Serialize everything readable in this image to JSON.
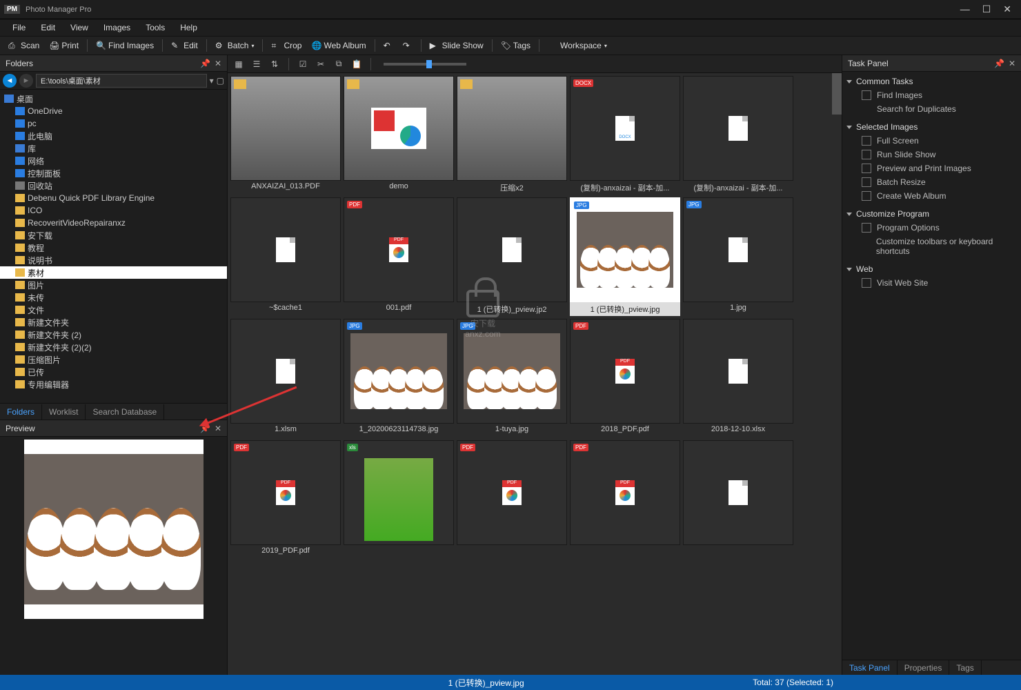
{
  "window": {
    "title": "Photo Manager Pro"
  },
  "menu": [
    "File",
    "Edit",
    "View",
    "Images",
    "Tools",
    "Help"
  ],
  "toolbar": [
    {
      "icon": "scan",
      "label": "Scan"
    },
    {
      "icon": "print",
      "label": "Print"
    },
    {
      "sep": true
    },
    {
      "icon": "find",
      "label": "Find Images"
    },
    {
      "sep": true
    },
    {
      "icon": "edit",
      "label": "Edit"
    },
    {
      "sep": true
    },
    {
      "icon": "batch",
      "label": "Batch",
      "dd": true
    },
    {
      "sep": true
    },
    {
      "icon": "crop",
      "label": "Crop"
    },
    {
      "icon": "web",
      "label": "Web Album"
    },
    {
      "sep": true
    },
    {
      "icon": "rotl",
      "label": ""
    },
    {
      "icon": "rotr",
      "label": ""
    },
    {
      "sep": true
    },
    {
      "icon": "slide",
      "label": "Slide Show"
    },
    {
      "sep": true
    },
    {
      "icon": "tags",
      "label": "Tags"
    },
    {
      "sep": true
    },
    {
      "icon": "ws",
      "label": "Workspace",
      "dd": true
    }
  ],
  "folders": {
    "title": "Folders",
    "path": "E:\\tools\\桌面\\素材",
    "root": "桌面",
    "items": [
      {
        "icon": "cloud",
        "label": "OneDrive",
        "ind": 1,
        "color": "#2a7de1"
      },
      {
        "icon": "pc",
        "label": "pc",
        "ind": 1,
        "color": "#2a7de1"
      },
      {
        "icon": "pc2",
        "label": "此电脑",
        "ind": 1,
        "color": "#2a7de1"
      },
      {
        "icon": "lib",
        "label": "库",
        "ind": 1,
        "color": "#3a7bd5"
      },
      {
        "icon": "net",
        "label": "网络",
        "ind": 1,
        "color": "#2a7de1"
      },
      {
        "icon": "cp",
        "label": "控制面板",
        "ind": 1,
        "color": "#2a7de1"
      },
      {
        "icon": "bin",
        "label": "回收站",
        "ind": 1,
        "color": "#777"
      },
      {
        "icon": "f",
        "label": "Debenu Quick PDF Library Engine",
        "ind": 1,
        "color": "#e8b84a"
      },
      {
        "icon": "f",
        "label": "ICO",
        "ind": 1,
        "color": "#e8b84a"
      },
      {
        "icon": "f",
        "label": "RecoveritVideoRepairanxz",
        "ind": 1,
        "color": "#e8b84a"
      },
      {
        "icon": "f",
        "label": "安下载",
        "ind": 1,
        "color": "#e8b84a"
      },
      {
        "icon": "f",
        "label": "教程",
        "ind": 1,
        "color": "#e8b84a"
      },
      {
        "icon": "f",
        "label": "说明书",
        "ind": 1,
        "color": "#e8b84a"
      },
      {
        "icon": "f",
        "label": "素材",
        "ind": 1,
        "color": "#e8b84a",
        "sel": true
      },
      {
        "icon": "f",
        "label": "图片",
        "ind": 1,
        "color": "#e8b84a"
      },
      {
        "icon": "f",
        "label": "未传",
        "ind": 1,
        "color": "#e8b84a"
      },
      {
        "icon": "f",
        "label": "文件",
        "ind": 1,
        "color": "#e8b84a"
      },
      {
        "icon": "f",
        "label": "新建文件夹",
        "ind": 1,
        "color": "#e8b84a"
      },
      {
        "icon": "f",
        "label": "新建文件夹 (2)",
        "ind": 1,
        "color": "#e8b84a"
      },
      {
        "icon": "f",
        "label": "新建文件夹 (2)(2)",
        "ind": 1,
        "color": "#e8b84a"
      },
      {
        "icon": "f",
        "label": "压缩图片",
        "ind": 1,
        "color": "#e8b84a"
      },
      {
        "icon": "f",
        "label": "已传",
        "ind": 1,
        "color": "#e8b84a"
      },
      {
        "icon": "f",
        "label": "专用编辑器",
        "ind": 1,
        "color": "#e8b84a"
      }
    ],
    "tabs": [
      "Folders",
      "Worklist",
      "Search Database"
    ]
  },
  "preview": {
    "title": "Preview"
  },
  "files": [
    {
      "type": "folder",
      "label": "ANXAIZAI_013.PDF"
    },
    {
      "type": "folder",
      "label": "demo",
      "demo": true
    },
    {
      "type": "folder",
      "label": "压缩x2"
    },
    {
      "type": "docx",
      "label": "(复制)-anxaizai - 副本-加...",
      "badge": "DOCX"
    },
    {
      "type": "doc",
      "label": "(复制)-anxaizai - 副本-加..."
    },
    {
      "type": "doc",
      "label": "~$cache1"
    },
    {
      "type": "pdfcolor",
      "label": "001.pdf"
    },
    {
      "type": "doc",
      "label": "1 (已转换)_pview.jp2"
    },
    {
      "type": "jpgpups",
      "label": "1 (已转换)_pview.jpg",
      "sel": true,
      "badge": "JPG"
    },
    {
      "type": "doc",
      "label": "1.jpg",
      "badge": "JPG"
    },
    {
      "type": "doc",
      "label": "1.xlsm"
    },
    {
      "type": "jpgpups",
      "label": "1_20200623114738.jpg",
      "badge": "JPG"
    },
    {
      "type": "jpgpups",
      "label": "1-tuya.jpg",
      "badge": "JPG"
    },
    {
      "type": "pdfcolor",
      "label": "2018_PDF.pdf",
      "badge": "PDF"
    },
    {
      "type": "doc",
      "label": "2018-12-10.xlsx"
    },
    {
      "type": "pdfcolor",
      "label": "2019_PDF.pdf",
      "badge": "PDF"
    },
    {
      "type": "girl",
      "label": "",
      "badge": "XLS"
    },
    {
      "type": "pdfcolor",
      "label": "",
      "badge": "PDF"
    },
    {
      "type": "pdfcolor",
      "label": "",
      "badge": "PDF"
    },
    {
      "type": "doc",
      "label": ""
    }
  ],
  "taskpanel": {
    "title": "Task Panel",
    "groups": [
      {
        "title": "Common Tasks",
        "items": [
          {
            "icon": "find",
            "label": "Find Images"
          },
          {
            "icon": "",
            "label": "Search for Duplicates"
          }
        ]
      },
      {
        "title": "Selected Images",
        "items": [
          {
            "icon": "full",
            "label": "Full Screen"
          },
          {
            "icon": "slide",
            "label": "Run Slide Show"
          },
          {
            "icon": "print",
            "label": "Preview and Print Images"
          },
          {
            "icon": "resize",
            "label": "Batch Resize"
          },
          {
            "icon": "web",
            "label": "Create Web Album"
          }
        ]
      },
      {
        "title": "Customize Program",
        "items": [
          {
            "icon": "gear",
            "label": "Program Options"
          },
          {
            "icon": "",
            "label": "Customize toolbars or keyboard shortcuts"
          }
        ]
      },
      {
        "title": "Web",
        "items": [
          {
            "icon": "globe",
            "label": "Visit Web Site"
          }
        ]
      }
    ],
    "tabs": [
      "Task Panel",
      "Properties",
      "Tags"
    ]
  },
  "status": {
    "file": "1 (已转换)_pview.jpg",
    "count": "Total: 37 (Selected: 1)"
  },
  "watermark": "安下载\nanxz.com"
}
